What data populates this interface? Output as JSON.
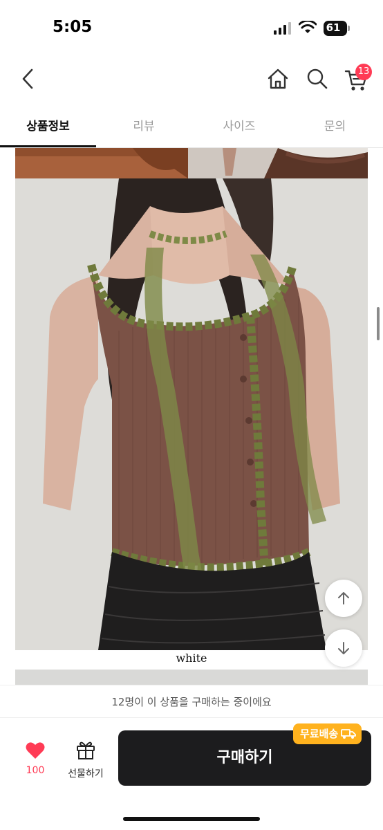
{
  "status_bar": {
    "time": "5:05",
    "battery": "61"
  },
  "header": {
    "cart_count": "13",
    "icons": [
      "back-chevron-icon",
      "home-icon",
      "search-icon",
      "cart-icon"
    ]
  },
  "tabs": [
    {
      "label": "상품정보",
      "active": true
    },
    {
      "label": "리뷰",
      "active": false
    },
    {
      "label": "사이즈",
      "active": false
    },
    {
      "label": "문의",
      "active": false
    }
  ],
  "product_image": {
    "caption": "white"
  },
  "notice": {
    "text": "12명이 이 상품을 구매하는 중이에요"
  },
  "bottom_bar": {
    "like_count": "100",
    "gift_label": "선물하기",
    "buy_label": "구매하기",
    "shipping_badge": "무료배송"
  },
  "colors": {
    "accent": "#ff3b55",
    "buy_button": "#1c1c1e",
    "shipping_badge": "#ffb21e"
  }
}
